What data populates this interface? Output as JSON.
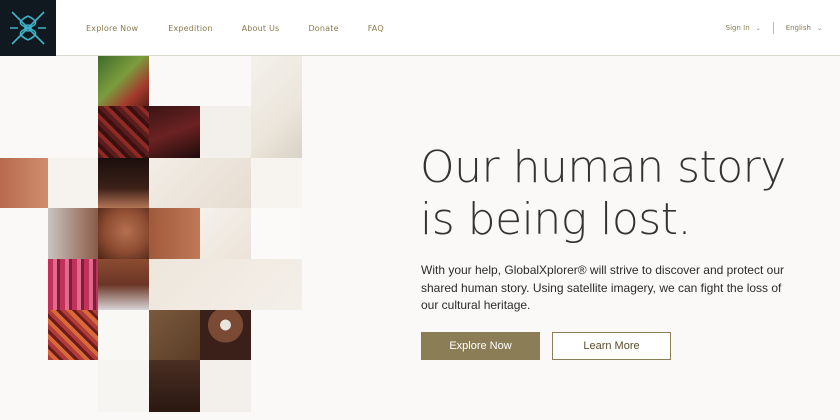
{
  "nav": {
    "items": [
      {
        "label": "Explore Now"
      },
      {
        "label": "Expedition"
      },
      {
        "label": "About Us"
      },
      {
        "label": "Donate"
      },
      {
        "label": "FAQ"
      }
    ],
    "sign_in": "Sign In",
    "language": "English"
  },
  "hero": {
    "title_line1": "Our human story",
    "title_line2": "is being lost.",
    "body": "With your help, GlobalXplorer® will strive to discover and protect our shared human story. Using satellite imagery, we can fight the loss of our cultural heritage.",
    "primary_button": "Explore Now",
    "secondary_button": "Learn More"
  },
  "colors": {
    "accent": "#8b7d55",
    "logo_bg": "#101820",
    "logo_line": "#3fb3c9"
  },
  "icons": [
    "logo-icon",
    "chevron-down-icon"
  ]
}
